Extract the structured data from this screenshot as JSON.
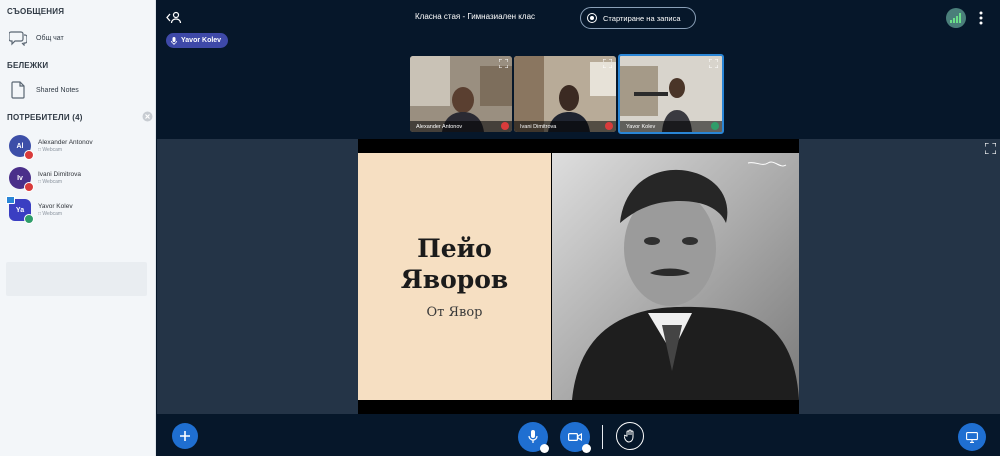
{
  "sidebar": {
    "messages_title": "СЪОБЩЕНИЯ",
    "public_chat": "Общ чат",
    "notes_title": "БЕЛЕЖКИ",
    "shared_notes": "Shared Notes",
    "users_title": "ПОТРЕБИТЕЛИ (4)",
    "users": [
      {
        "initials": "Al",
        "name": "Alexander Antonov",
        "status": "□ Webcam",
        "color": "#3d4fa8"
      },
      {
        "initials": "Iv",
        "name": "Ivani Dimitrova",
        "status": "□ Webcam",
        "color": "#4a2f8a"
      },
      {
        "initials": "Ya",
        "name": "Yavor Kolev",
        "status": "□ Webcam",
        "color": "#3a3ec2"
      }
    ]
  },
  "header": {
    "room_title": "Класна стая - Гимназиален клас",
    "record_label": "Стартиране на записа"
  },
  "talker": "Yavor Kolev",
  "videos": [
    {
      "name": "Alexander Antonov"
    },
    {
      "name": "Ivani Dimitrova"
    },
    {
      "name": "Yavor Kolev"
    }
  ],
  "slide": {
    "title_line1": "Пейо",
    "title_line2": "Яворов",
    "subtitle": "От Явор"
  },
  "colors": {
    "accent": "#1f6fd1",
    "background": "#06172a",
    "mic_muted": "#d93b3b",
    "mic_on": "#2f9d6a"
  }
}
